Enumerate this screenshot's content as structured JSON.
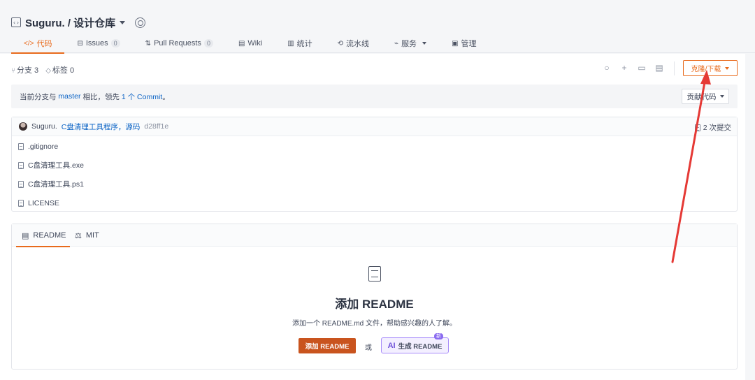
{
  "repo": {
    "title": "Suguru. / 设计仓库"
  },
  "tabs": [
    {
      "icon": "</>",
      "label": "代码"
    },
    {
      "icon": "⊟",
      "label": "Issues",
      "count": "0"
    },
    {
      "icon": "⇅",
      "label": "Pull Requests",
      "count": "0"
    },
    {
      "icon": "▤",
      "label": "Wiki"
    },
    {
      "icon": "▥",
      "label": "统计"
    },
    {
      "icon": "⟲",
      "label": "流水线"
    },
    {
      "icon": "⌁",
      "label": "服务"
    },
    {
      "icon": "▣",
      "label": "管理"
    }
  ],
  "branch": {
    "branches": "分支 3",
    "tags": "标签 0"
  },
  "clone_button": "克隆/下载",
  "compare": {
    "prefix": "当前分支与",
    "branch": "master",
    "mid": "相比，领先",
    "commit_link": "1 个 Commit",
    "suffix": "。"
  },
  "contribute_button": "贡献代码",
  "commit": {
    "author": "Suguru.",
    "message": "C盘清理工具程序，源码",
    "sha": "d28ff1e",
    "count": "2 次提交"
  },
  "files": [
    ".gitignore",
    "C盘清理工具.exe",
    "C盘清理工具.ps1",
    "LICENSE"
  ],
  "readme": {
    "tab_readme": "README",
    "tab_license": "MIT",
    "heading": "添加 README",
    "subtitle": "添加一个 README.md 文件，帮助感兴趣的人了解。",
    "add_button": "添加 README",
    "or": "或",
    "ai_prefix": "AI",
    "ai_button": "生成 README",
    "ai_tag": "新"
  },
  "colors": {
    "accent": "#e86a1c",
    "link": "#0b63c5",
    "annotation_arrow": "#e53935"
  }
}
